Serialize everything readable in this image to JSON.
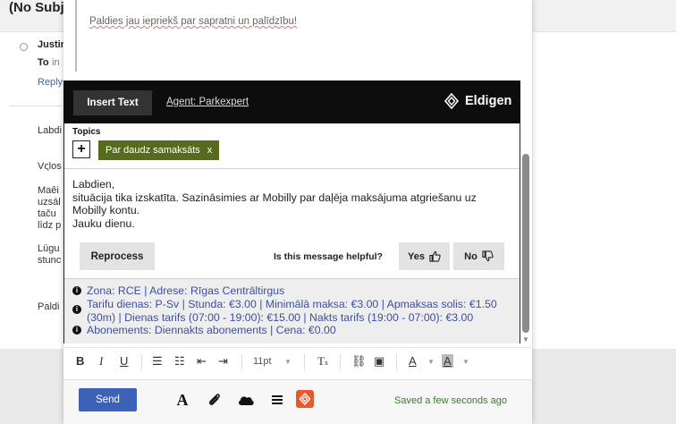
{
  "background": {
    "subject": "(No Subj",
    "from": "Justin",
    "to_label": "To",
    "to_value": "in",
    "reply": "Reply",
    "snippets": [
      "Labdi",
      "Vςlos",
      "Maêi",
      "uzsāl",
      "taču",
      "līdz p",
      "Lūgu",
      "stunc",
      "Paldi"
    ]
  },
  "compose": {
    "quoted_text": "Paldies jau iepriekš par sapratni un palīdzību!"
  },
  "plugin": {
    "tabs": {
      "insert_text": "Insert Text",
      "agent": "Agent: Parkexpert"
    },
    "brand": "Eldigen",
    "topics_label": "Topics",
    "add_topic": "+",
    "topic_chip": "Par daudz samaksāts",
    "topic_remove": "x",
    "message_lines": [
      "Labdien,",
      "situācija tika izskatīta. Sazināsimies ar Mobilly par daļēja maksājuma atgriešanu uz",
      "Mobilly kontu.",
      "Jauku dienu."
    ],
    "reprocess": "Reprocess",
    "helpful_question": "Is this message helpful?",
    "yes": "Yes",
    "no": "No",
    "info_rows": [
      "Zona: RCE | Adrese: Rīgas Centrāltirgus",
      "Tarifu dienas: P-Sv | Stunda: €3.00 | Minimālā maksa: €3.00 | Apmaksas solis: €1.50 (30m) | Dienas tarifs (07:00 - 19:00): €15.00 | Nakts tarifs (19:00 - 07:00): €3.00",
      "Abonements: Diennakts abonements | Cena: €0.00"
    ],
    "info_icon": "i"
  },
  "toolbar": {
    "font_size": "11pt"
  },
  "bottom": {
    "send": "Send",
    "saved_status": "Saved a few seconds ago"
  },
  "colors": {
    "chip": "#556b1e",
    "send": "#3c62b8",
    "info_link": "#3e4f9e",
    "eldigen_orange": "#e85a2c"
  }
}
